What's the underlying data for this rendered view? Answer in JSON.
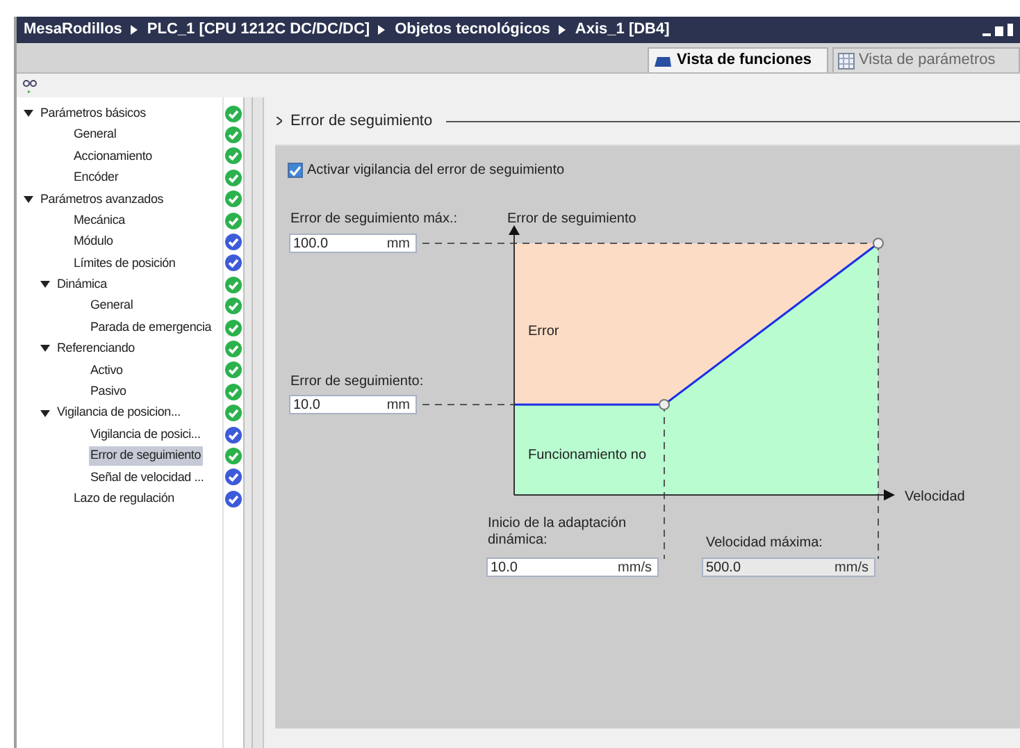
{
  "breadcrumb": [
    "MesaRodillos",
    "PLC_1 [CPU 1212C DC/DC/DC]",
    "Objetos tecnológicos",
    "Axis_1 [DB4]"
  ],
  "tabs": [
    {
      "label": "Vista de funciones",
      "selected": true,
      "kind": "functions"
    },
    {
      "label": "Vista de parámetros",
      "selected": false,
      "kind": "params"
    }
  ],
  "tree": [
    {
      "label": "Parámetros básicos",
      "expanded": true,
      "selected": false,
      "color": "#2bb24c",
      "children": [
        {
          "label": "General",
          "selected": false,
          "color": "#2bb24c"
        },
        {
          "label": "Accionamiento",
          "selected": false,
          "color": "#2bb24c"
        },
        {
          "label": "Encóder",
          "selected": false,
          "color": "#2bb24c"
        }
      ]
    },
    {
      "label": "Parámetros avanzados",
      "expanded": true,
      "selected": false,
      "color": "#2bb24c",
      "children": [
        {
          "label": "Mecánica",
          "selected": false,
          "color": "#2bb24c"
        },
        {
          "label": "Módulo",
          "selected": false,
          "color": "#3d5bd9"
        },
        {
          "label": "Límites de posición",
          "selected": false,
          "color": "#3d5bd9"
        },
        {
          "label": "Dinámica",
          "expanded": true,
          "selected": false,
          "color": "#2bb24c",
          "children": [
            {
              "label": "General",
              "selected": false,
              "color": "#2bb24c"
            },
            {
              "label": "Parada de emergencia",
              "selected": false,
              "color": "#2bb24c"
            }
          ]
        },
        {
          "label": "Referenciando",
          "expanded": true,
          "selected": false,
          "color": "#2bb24c",
          "children": [
            {
              "label": "Activo",
              "selected": false,
              "color": "#2bb24c"
            },
            {
              "label": "Pasivo",
              "selected": false,
              "color": "#2bb24c"
            }
          ]
        },
        {
          "label": "Vigilancia de posicion...",
          "expanded": true,
          "selected": false,
          "color": "#2bb24c",
          "children": [
            {
              "label": "Vigilancia de posici...",
              "selected": false,
              "color": "#3d5bd9"
            },
            {
              "label": "Error de seguimiento",
              "selected": true,
              "color": "#2bb24c"
            },
            {
              "label": "Señal de velocidad ...",
              "selected": false,
              "color": "#3d5bd9"
            }
          ]
        },
        {
          "label": "Lazo de regulación",
          "selected": false,
          "color": "#3d5bd9"
        }
      ]
    }
  ],
  "section_title": "Error de seguimiento",
  "enable": {
    "label": "Activar vigilancia del error de seguimiento",
    "checked": true
  },
  "diagram": {
    "max_error": {
      "label": "Error de seguimiento máx.:",
      "value": "100.0",
      "unit": "mm"
    },
    "error": {
      "label": "Error de seguimiento:",
      "value": "10.0",
      "unit": "mm"
    },
    "y_axis": "Error de seguimiento",
    "x_axis": "Velocidad",
    "region_error": "Error",
    "region_ok": "Funcionamiento no",
    "start": {
      "label": "Inicio de la adaptación",
      "label_2": "dinámica:",
      "value": "10.0",
      "unit": "mm/s"
    },
    "vmax": {
      "label": "Velocidad máxima:",
      "value": "500.0",
      "unit": "mm/s",
      "disabled": true
    }
  }
}
